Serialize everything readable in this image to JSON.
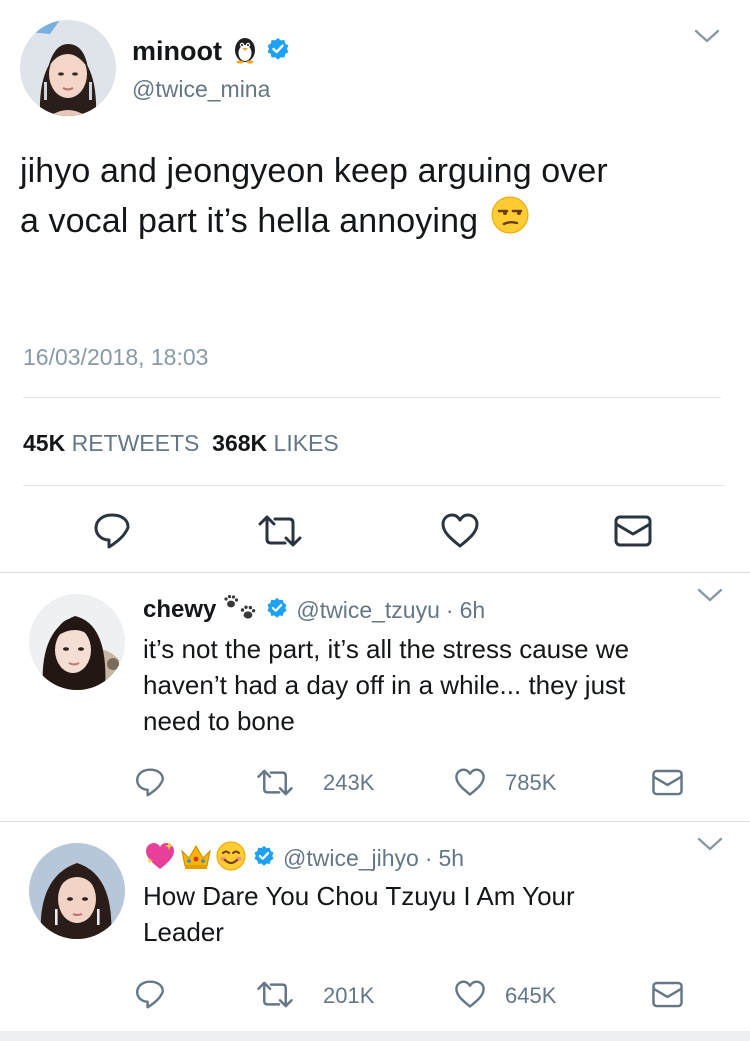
{
  "main_tweet": {
    "display_name": "minoot",
    "name_emoji": "penguin-emoji",
    "handle": "@twice_mina",
    "text_line1": "jihyo and jeongyeon keep arguing over",
    "text_line2": "a vocal part it’s hella annoying",
    "text_emoji": "unamused-face-emoji",
    "timestamp": "16/03/2018, 18:03",
    "retweets_count": "45K",
    "retweets_label": "RETWEETS",
    "likes_count": "368K",
    "likes_label": "LIKES"
  },
  "replies": [
    {
      "display_name": "chewy",
      "name_emoji": "paw-prints-emoji",
      "handle": "@twice_tzuyu",
      "separator": "·",
      "time": "6h",
      "text_line1": "it’s not the part, it’s all the stress cause we",
      "text_line2": "haven’t had a day off in a while... they just",
      "text_line3": "need to bone",
      "retweets": "243K",
      "likes": "785K"
    },
    {
      "display_name_emojis": [
        "sparkling-heart-emoji",
        "crown-emoji",
        "smiling-face-emoji"
      ],
      "handle": "@twice_jihyo",
      "separator": "·",
      "time": "5h",
      "text_line1": "How Dare You Chou Tzuyu I Am Your",
      "text_line2": "Leader",
      "retweets": "201K",
      "likes": "645K"
    }
  ],
  "colors": {
    "verified_blue": "#1da1f2",
    "icon_gray": "#657786",
    "action_icon_dark": "#2a3540",
    "divider": "#e1e8ed"
  }
}
